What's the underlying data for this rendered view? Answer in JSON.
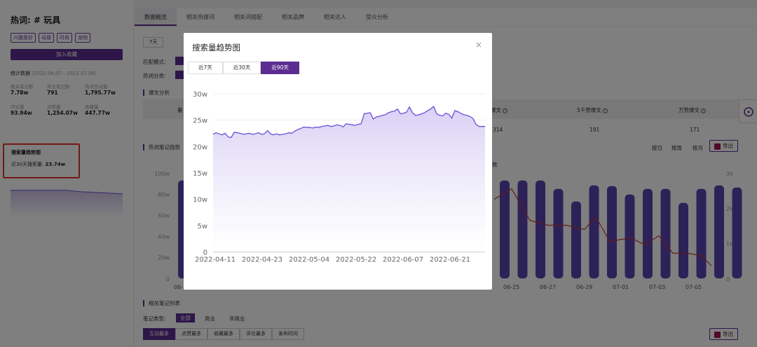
{
  "left": {
    "hot_prefix": "热词: ",
    "hot_word": "# 玩具",
    "tags": [
      "兴趣爱好",
      "母婴",
      "时尚",
      "宠物"
    ],
    "collect_label": "加入收藏",
    "stat_label": "统计数据",
    "stat_range": "(2022.06.07 - 2022.07.06)",
    "stats": [
      {
        "label": "相关笔记数",
        "value": "7.78w"
      },
      {
        "label": "商业笔记数",
        "value": "791"
      },
      {
        "label": "热词互动量",
        "value": "1,795.77w"
      },
      {
        "label": "评论量",
        "value": "93.94w"
      },
      {
        "label": "点赞量",
        "value": "1,254.07w"
      },
      {
        "label": "收藏量",
        "value": "447.77w"
      }
    ],
    "trend_title": "搜索量趋势图",
    "trend_label": "近30天搜索量: ",
    "trend_value": "23.74w"
  },
  "main": {
    "tabs": [
      "数据概览",
      "相关热搜词",
      "相关词搭配",
      "相关品牌",
      "相关达人",
      "受众分析"
    ],
    "period_btn": "7天",
    "match_mode_label": "匹配模式:",
    "hot_category_label": "热词分类:",
    "burst_section": "爆文分析",
    "table_headers": [
      "爆文",
      "5千赞爆文",
      "万赞爆文"
    ],
    "table_values": [
      "314",
      "191",
      "171"
    ],
    "notes_trend_section": "热词笔记趋势",
    "range_buttons": [
      "按日",
      "按周",
      "按月"
    ],
    "export_label": "导出",
    "legend_fragment": "数",
    "left_axis": [
      "100w",
      "80w",
      "60w",
      "40w",
      "20w",
      "0"
    ],
    "right_axis": [
      "3k",
      "2k",
      "1k",
      "0"
    ],
    "bottom_ticks": [
      "06-25",
      "06-27",
      "06-29",
      "07-01",
      "07-03",
      "07-05"
    ],
    "first_tick_fragment": "06-",
    "notes_list_section": "相关笔记列表",
    "note_type_label": "笔记类型:",
    "note_types": [
      "全部",
      "商业",
      "非商业"
    ],
    "sort_buttons": [
      "互动最多",
      "点赞最多",
      "收藏最多",
      "评论最多",
      "发布时间"
    ]
  },
  "modal": {
    "title": "搜索量趋势图",
    "close": "×",
    "tabs": [
      "近7天",
      "近30天",
      "近90天"
    ],
    "active_tab": 2
  },
  "chart_data": {
    "type": "area",
    "title": "",
    "y_ticks": [
      "0",
      "5w",
      "10w",
      "15w",
      "20w",
      "25w",
      "30w"
    ],
    "x_ticks": [
      "2022-04-11",
      "2022-04-23",
      "2022-05-04",
      "2022-05-22",
      "2022-06-07",
      "2022-06-21"
    ],
    "ylim": [
      0,
      30
    ],
    "y_unit": "w",
    "series": [
      {
        "values": [
          22.3,
          22.6,
          22.4,
          22.2,
          22.5,
          21.8,
          21.7,
          22.7,
          22.6,
          22.5,
          22.3,
          22.4,
          22.5,
          22.3,
          22.4,
          22.6,
          22.3,
          22.4,
          23.0,
          22.4,
          22.2,
          22.4,
          22.2,
          22.3,
          22.4,
          22.6,
          22.5,
          22.9,
          23.2,
          23.4,
          23.7,
          23.6,
          23.6,
          23.5,
          23.7,
          23.6,
          23.8,
          23.9,
          24.0,
          23.8,
          23.9,
          24.1,
          24.0,
          23.7,
          24.3,
          24.2,
          24.1,
          24.0,
          24.2,
          24.3,
          26.2,
          26.3,
          26.4,
          25.2,
          25.6,
          25.7,
          25.9,
          26.0,
          26.4,
          26.6,
          26.7,
          27.1,
          26.2,
          26.3,
          26.5,
          27.5,
          26.4,
          25.9,
          26.0,
          26.2,
          26.4,
          26.8,
          27.1,
          27.6,
          26.2,
          25.9,
          25.8,
          26.3,
          26.1,
          25.4,
          26.8,
          26.6,
          26.3,
          26.0,
          25.9,
          25.7,
          25.3,
          24.2,
          23.8,
          23.8,
          23.8
        ]
      }
    ],
    "series_color": "#6b4fd8",
    "grid": true
  },
  "colors": {
    "brand": "#5c2d91",
    "highlight_box": "#e8322c",
    "line": "#6b4fd8",
    "bars": "#5a44b0"
  }
}
